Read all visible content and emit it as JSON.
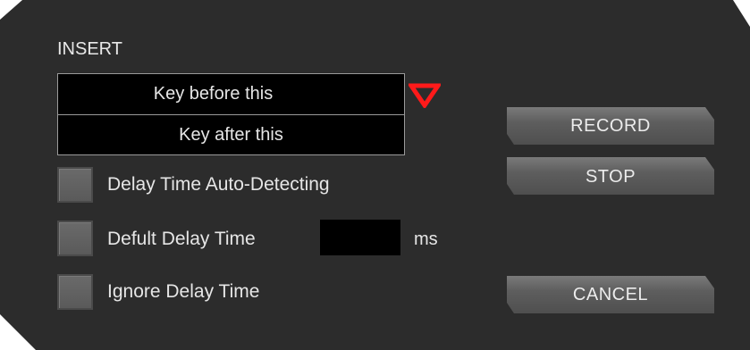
{
  "insert": {
    "label": "INSERT",
    "options": [
      {
        "label": "Key before this",
        "selected": true
      },
      {
        "label": "Key after this",
        "selected": false
      }
    ],
    "indicator_color": "#ff1a1a"
  },
  "options": {
    "auto_detect": {
      "label": "Delay Time Auto-Detecting",
      "checked": false
    },
    "default_delay": {
      "label": "Defult Delay Time",
      "checked": false,
      "value": "",
      "unit": "ms"
    },
    "ignore_delay": {
      "label": "Ignore Delay Time",
      "checked": false
    }
  },
  "buttons": {
    "record": "RECORD",
    "stop": "STOP",
    "cancel": "CANCEL"
  },
  "colors": {
    "panel_bg": "#2c2c2c",
    "field_bg": "#000000",
    "text": "#e6e6e6",
    "accent_red": "#ff1a1a"
  }
}
